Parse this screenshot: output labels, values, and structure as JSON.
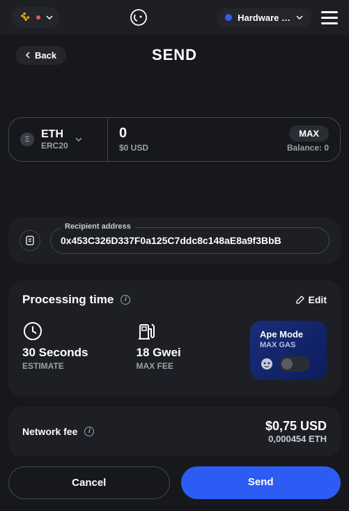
{
  "header": {
    "wallet_label": "Hardware …"
  },
  "nav": {
    "back_label": "Back",
    "title": "SEND"
  },
  "asset": {
    "symbol": "ETH",
    "chain": "ERC20",
    "amount": "0",
    "amount_fiat": "$0 USD",
    "max_label": "MAX",
    "balance_label": "Balance: 0"
  },
  "recipient": {
    "label": "Recipient address",
    "value": "0x453C326D337F0a125C7ddc8c148aE8a9f3BbB"
  },
  "processing": {
    "title": "Processing time",
    "edit_label": "Edit",
    "time_value": "30 Seconds",
    "time_sub": "ESTIMATE",
    "gas_value": "18 Gwei",
    "gas_sub": "MAX FEE",
    "ape": {
      "title": "Ape Mode",
      "sub": "MAX GAS"
    }
  },
  "fee": {
    "label": "Network fee",
    "usd": "$0,75 USD",
    "eth": "0,000454 ETH"
  },
  "actions": {
    "cancel": "Cancel",
    "send": "Send"
  }
}
